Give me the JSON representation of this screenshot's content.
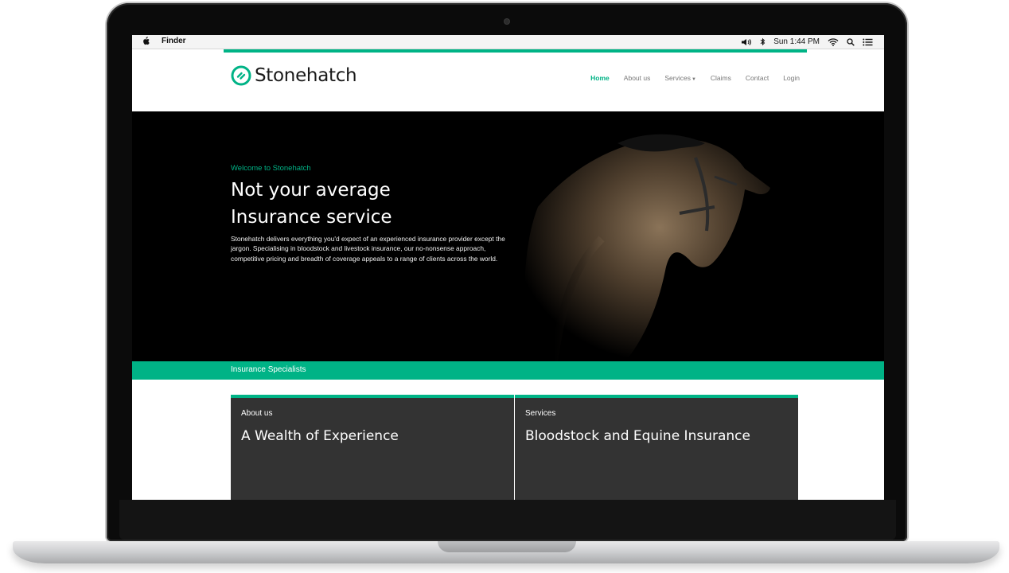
{
  "menubar": {
    "app_name": "Finder",
    "clock": "Sun 1:44 PM",
    "icons": [
      "apple-icon",
      "volume-icon",
      "bluetooth-icon",
      "wifi-icon",
      "search-icon",
      "list-icon"
    ]
  },
  "site": {
    "brand": "Stonehatch",
    "accent_color": "#00b386",
    "nav": [
      {
        "label": "Home",
        "active": true
      },
      {
        "label": "About us",
        "active": false
      },
      {
        "label": "Services",
        "active": false
      },
      {
        "label": "Claims",
        "active": false
      },
      {
        "label": "Contact",
        "active": false
      },
      {
        "label": "Login",
        "active": false
      }
    ],
    "hero": {
      "welcome": "Welcome to Stonehatch",
      "headline_line1": "Not your average",
      "headline_line2": "Insurance service",
      "intro": "Stonehatch delivers everything you'd expect of an experienced insurance provider except the jargon. Specialising in bloodstock and livestock insurance, our no-nonsense approach, competitive pricing and breadth of coverage appeals to a range of clients across the world."
    },
    "specialists_label": "Insurance Specialists",
    "cards": [
      {
        "kicker": "About us",
        "title": "A Wealth of Experience"
      },
      {
        "kicker": "Services",
        "title": "Bloodstock and Equine Insurance"
      }
    ]
  }
}
